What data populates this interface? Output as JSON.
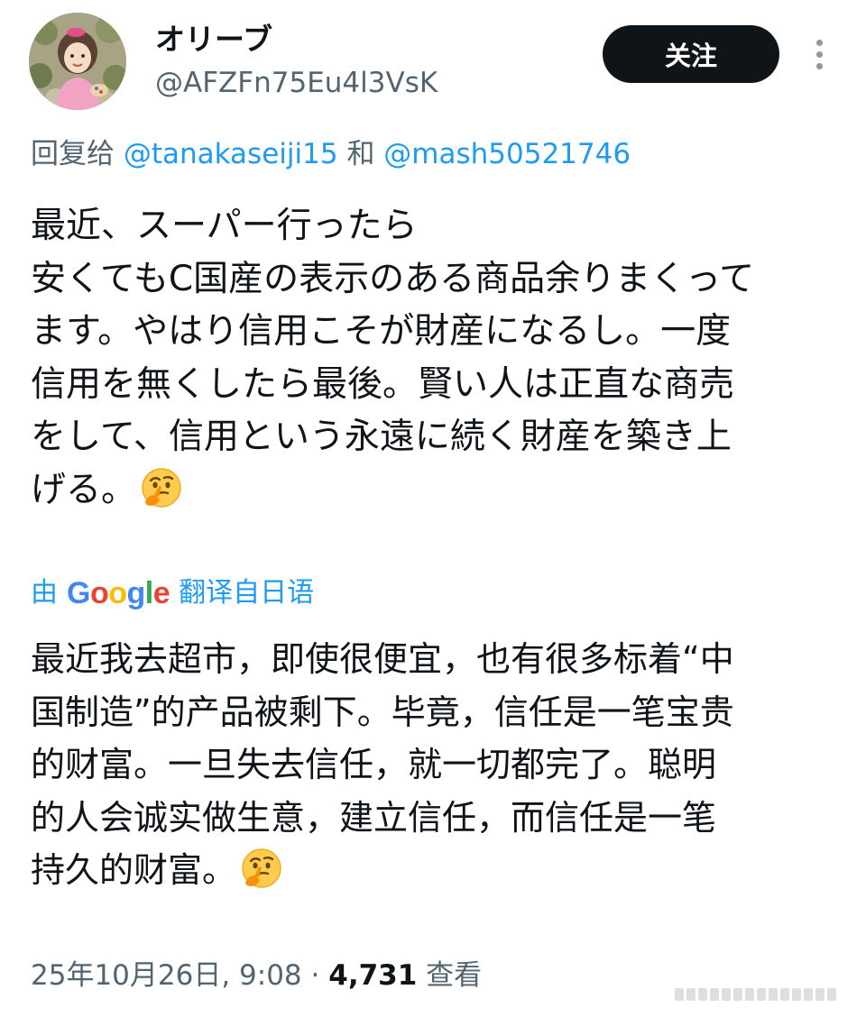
{
  "author": {
    "display_name": "オリーブ",
    "handle": "@AFZFn75Eu4l3VsK",
    "avatar_icon": "avatar-icon"
  },
  "actions": {
    "follow_label": "关注",
    "more_icon": "more-vertical-icon"
  },
  "reply": {
    "prefix": "回复给",
    "mention_1": "@tanakaseiji15",
    "conjunction": "和",
    "mention_2": "@mash50521746"
  },
  "tweet": {
    "lines": [
      "最近、スーパー行ったら",
      "安くてもC国産の表示のある商品余りまくって",
      "ます。やはり信用こそが財産になるし。一度",
      "信用を無くしたら最後。賢い人は正直な商売",
      "をして、信用という永遠に続く財産を築き上",
      "げる。"
    ],
    "emoji": "thinking-face-emoji"
  },
  "translation": {
    "prefix": "由",
    "provider_letters": [
      "G",
      "o",
      "o",
      "g",
      "l",
      "e"
    ],
    "provider_colors": [
      "#4285F4",
      "#EA4335",
      "#FBBC05",
      "#4285F4",
      "#34A853",
      "#EA4335"
    ],
    "suffix": "翻译自日语",
    "lines": [
      "最近我去超市，即使很便宜，也有很多标着“中",
      "国制造”的产品被剩下。毕竟，信任是一笔宝贵",
      "的财富。一旦失去信任，就一切都完了。聪明",
      "的人会诚实做生意，建立信任，而信任是一笔",
      "持久的财富。"
    ],
    "emoji": "thinking-face-emoji"
  },
  "meta": {
    "timestamp": "25年10月26日, 9:08",
    "separator": "·",
    "views_count": "4,731",
    "views_label": "查看"
  },
  "colors": {
    "text": "#0f1419",
    "secondary": "#536471",
    "link": "#1d9bf0",
    "follow_bg": "#0f1419"
  }
}
